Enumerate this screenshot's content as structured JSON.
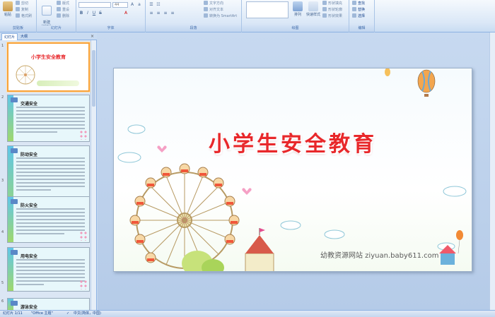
{
  "ribbon": {
    "clipboard": {
      "label": "剪贴板",
      "paste": "粘贴",
      "cut": "剪切",
      "copy": "复制",
      "format_painter": "格式刷"
    },
    "slides": {
      "label": "幻灯片",
      "new_slide": "新建\n幻灯片",
      "layout": "版式",
      "reset": "重设",
      "delete": "删除"
    },
    "font": {
      "label": "字体",
      "font_size": "44"
    },
    "paragraph": {
      "label": "段落",
      "text_direction": "文字方向",
      "align_text": "对齐文本",
      "smartart": "转换为 SmartArt"
    },
    "drawing": {
      "label": "绘图",
      "arrange": "排列",
      "quick_styles": "快速样式",
      "shape_fill": "形状填充",
      "shape_outline": "形状轮廓",
      "shape_effects": "形状效果"
    },
    "editing": {
      "label": "编辑",
      "find": "查找",
      "replace": "替换",
      "select": "选择"
    }
  },
  "panel": {
    "tabs": [
      "幻灯片",
      "大纲"
    ],
    "thumbnails": [
      {
        "num": "1",
        "title": "小学生安全教育"
      },
      {
        "num": "2",
        "title": "交通安全"
      },
      {
        "num": "3",
        "title": "防动安全"
      },
      {
        "num": "4",
        "title": "防火安全"
      },
      {
        "num": "5",
        "title": "用电安全"
      },
      {
        "num": "6",
        "title": "游泳安全"
      }
    ]
  },
  "slide": {
    "title": "小学生安全教育",
    "site": "幼教资源网站  ziyuan.baby611.com"
  },
  "status": {
    "slide_count": "幻灯片 1/11",
    "theme": "\"Office 主题\"",
    "language": "中文(简体，中国)"
  },
  "colors": {
    "title_red": "#e8282b",
    "selected_border": "#f7a23b",
    "ribbon_blue": "#15428b"
  }
}
